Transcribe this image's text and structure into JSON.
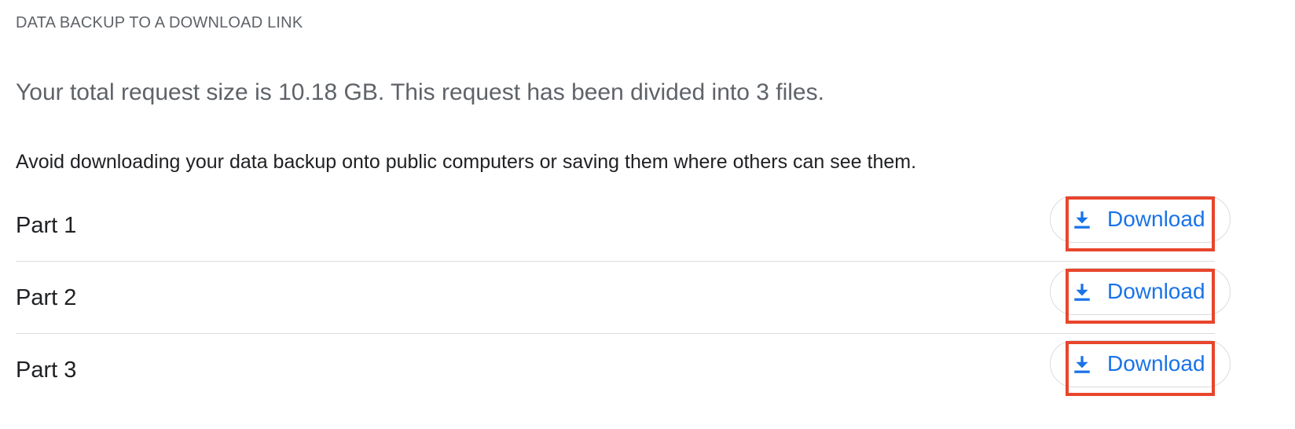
{
  "section": {
    "title": "DATA BACKUP TO A DOWNLOAD LINK"
  },
  "summary": "Your total request size is 10.18 GB. This request has been divided into 3 files.",
  "warning": "Avoid downloading your data backup onto public computers or saving them where others can see them.",
  "parts": [
    {
      "label": "Part 1",
      "button_label": "Download",
      "icon": "download-icon"
    },
    {
      "label": "Part 2",
      "button_label": "Download",
      "icon": "download-icon"
    },
    {
      "label": "Part 3",
      "button_label": "Download",
      "icon": "download-icon"
    }
  ],
  "colors": {
    "accent": "#1a73e8",
    "highlight": "#e8452c",
    "muted_text": "#5f6368",
    "text": "#202124",
    "divider": "#dadce0"
  }
}
